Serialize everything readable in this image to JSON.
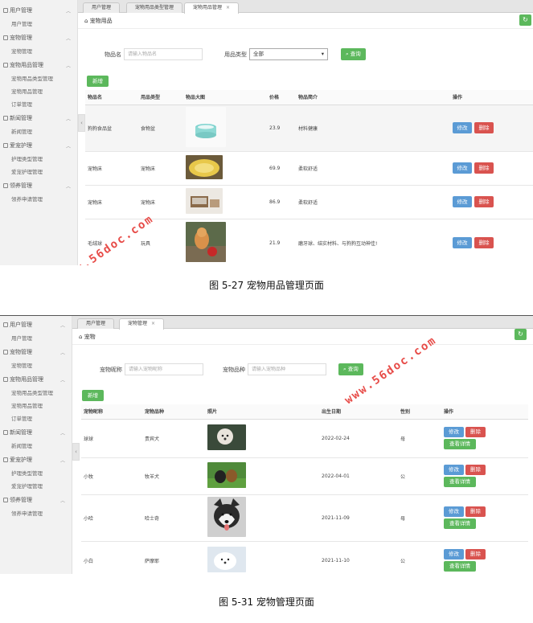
{
  "sidebar": {
    "groups": [
      {
        "label": "用户管理",
        "items": [
          "用户管理"
        ]
      },
      {
        "label": "宠物管理",
        "items": [
          "宠物管理"
        ]
      },
      {
        "label": "宠物用品管理",
        "items": [
          "宠物用品类型管理",
          "宠物用品管理",
          "订单管理"
        ]
      },
      {
        "label": "新闻管理",
        "items": [
          "新闻管理"
        ]
      },
      {
        "label": "爱宠护理",
        "items": [
          "护理类型管理",
          "爱宠护理管理"
        ]
      },
      {
        "label": "领养管理",
        "items": [
          "领养申请管理"
        ]
      }
    ]
  },
  "fig1": {
    "tabs": [
      "用户管理",
      "宠物用品类型管理",
      "宠物用品管理"
    ],
    "breadcrumb": "宠物用品",
    "search": {
      "name_label": "物品名",
      "name_placeholder": "请输入物品名",
      "type_label": "用品类型",
      "type_value": "全部",
      "query_label": "查询"
    },
    "add_label": "新增",
    "columns": [
      "物品名",
      "用品类型",
      "物品大图",
      "价格",
      "物品简介",
      "操作"
    ],
    "rows": [
      {
        "name": "狗狗食品盆",
        "type": "食物盆",
        "price": "23.9",
        "desc": "材料健康",
        "img": "bowl"
      },
      {
        "name": "宠物床",
        "type": "宠物床",
        "price": "69.9",
        "desc": "柔软舒适",
        "img": "bed-yellow"
      },
      {
        "name": "宠物床",
        "type": "宠物床",
        "price": "86.9",
        "desc": "柔软舒适",
        "img": "bed-wood"
      },
      {
        "name": "毛绒球",
        "type": "玩具",
        "price": "21.9",
        "desc": "磨牙球、结实材料、与狗狗互动神佳!",
        "img": "dog-ball"
      }
    ],
    "edit_label": "修改",
    "delete_label": "删除",
    "caption": "图 5-27 宠物用品管理页面"
  },
  "fig2": {
    "tabs": [
      "用户管理",
      "宠物管理"
    ],
    "breadcrumb": "宠物",
    "search": {
      "nick_label": "宠物昵称",
      "nick_placeholder": "请输入宠物昵称",
      "breed_label": "宠物品种",
      "breed_placeholder": "请输入宠物品种",
      "query_label": "查询"
    },
    "add_label": "新增",
    "columns": [
      "宠物昵称",
      "宠物品种",
      "照片",
      "出生日期",
      "性别",
      "操作"
    ],
    "rows": [
      {
        "nick": "球球",
        "breed": "贵宾犬",
        "birth": "2022-02-24",
        "sex": "母",
        "img": "poodle"
      },
      {
        "nick": "小牧",
        "breed": "牧羊犬",
        "birth": "2022-04-01",
        "sex": "公",
        "img": "shepherd"
      },
      {
        "nick": "小哈",
        "breed": "哈士奇",
        "birth": "2021-11-09",
        "sex": "母",
        "img": "husky"
      },
      {
        "nick": "小白",
        "breed": "萨摩耶",
        "birth": "2021-11-10",
        "sex": "公",
        "img": "samoyed"
      }
    ],
    "edit_label": "修改",
    "delete_label": "删除",
    "detail_label": "查看详情",
    "caption": "图 5-31 宠物管理页面"
  },
  "watermark": "www.56doc.com",
  "colors": {
    "green": "#5cb85c",
    "blue": "#5b9bd5",
    "red": "#d9534f"
  }
}
